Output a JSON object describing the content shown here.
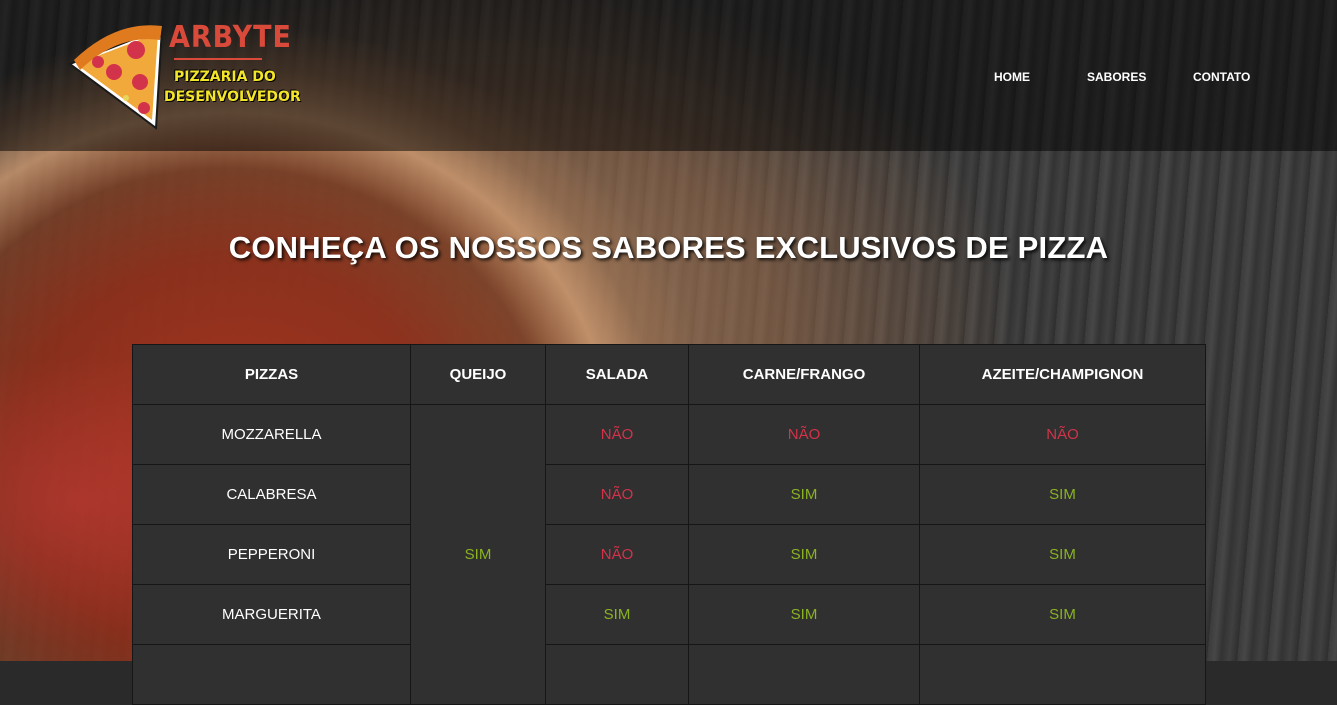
{
  "brand": {
    "name": "ARBYTE",
    "tagline_line1": "PIZZARIA DO",
    "tagline_line2": "DESENVOLVEDOR"
  },
  "nav": {
    "home": "HOME",
    "sabores": "SABORES",
    "contato": "CONTATO"
  },
  "heading": "CONHEÇA OS NOSSOS SABORES EXCLUSIVOS DE PIZZA",
  "table": {
    "headers": [
      "PIZZAS",
      "QUEIJO",
      "SALADA",
      "CARNE/FRANGO",
      "AZEITE/CHAMPIGNON"
    ],
    "queijo_all": "SIM",
    "rows": [
      {
        "pizza": "MOZZARELLA",
        "salada": "NÃO",
        "carne": "NÃO",
        "azeite": "NÃO"
      },
      {
        "pizza": "CALABRESA",
        "salada": "NÃO",
        "carne": "SIM",
        "azeite": "SIM"
      },
      {
        "pizza": "PEPPERONI",
        "salada": "NÃO",
        "carne": "SIM",
        "azeite": "SIM"
      },
      {
        "pizza": "MARGUERITA",
        "salada": "SIM",
        "carne": "SIM",
        "azeite": "SIM"
      },
      {
        "pizza": "",
        "salada": "",
        "carne": "",
        "azeite": ""
      }
    ]
  },
  "colors": {
    "no": "#d2334a",
    "yes": "#8ab322",
    "logo_red": "#d94a3a",
    "logo_yellow": "#f3e62a"
  },
  "icons": {
    "logo": "pizza-slice-icon"
  }
}
